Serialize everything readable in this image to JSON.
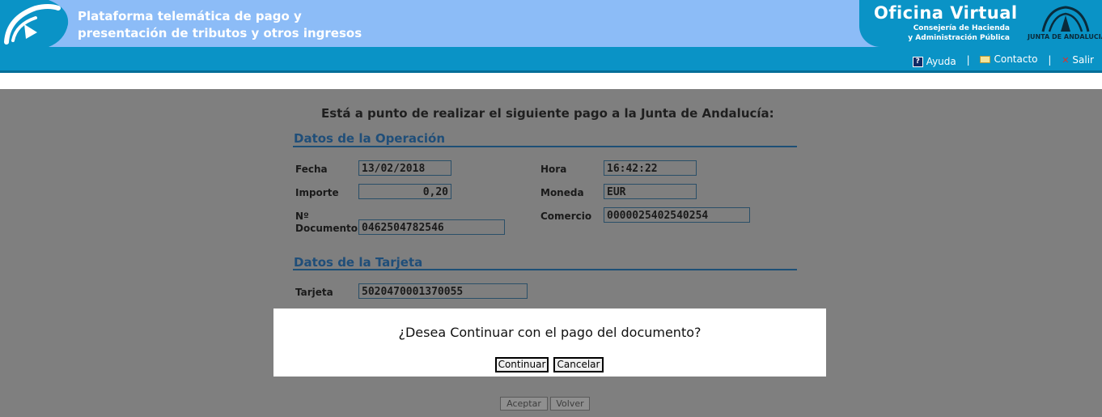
{
  "header": {
    "platform_line1": "Plataforma telemática de pago y",
    "platform_line2": "presentación de tributos y otros ingresos",
    "office_title": "Oficina Virtual",
    "office_sub1": "Consejería de Hacienda",
    "office_sub2": "y Administración Pública",
    "junta_logo_text": "JUNTA DE ANDALUCIA",
    "links": {
      "help": "Ayuda",
      "contact": "Contacto",
      "exit": "Salir"
    },
    "link_separator": "|"
  },
  "content": {
    "heading": "Está a punto de realizar el siguiente pago a la Junta de Andalucía:",
    "operation_title": "Datos de la Operación",
    "fecha_label": "Fecha",
    "fecha_value": "13/02/2018",
    "hora_label": "Hora",
    "hora_value": "16:42:22",
    "importe_label": "Importe",
    "importe_value": "0,20",
    "moneda_label": "Moneda",
    "moneda_value": "EUR",
    "doc_label_line1": "Nº",
    "doc_label_line2": "Documento",
    "doc_value": "0462504782546",
    "comercio_label": "Comercio",
    "comercio_value": "0000025402540254",
    "card_title": "Datos de la Tarjeta",
    "tarjeta_label": "Tarjeta",
    "tarjeta_value": "5020470001370055"
  },
  "dialog": {
    "message": "¿Desea Continuar con el pago del documento?",
    "continue_label": "Continuar",
    "cancel_label": "Cancelar"
  },
  "footer": {
    "accept_label": "Aceptar",
    "back_label": "Volver"
  },
  "colors": {
    "header_band": "#8cbcf7",
    "header_blue": "#0a93c6",
    "overlay": "#7f7f7f",
    "section_title": "#1f4e79"
  }
}
